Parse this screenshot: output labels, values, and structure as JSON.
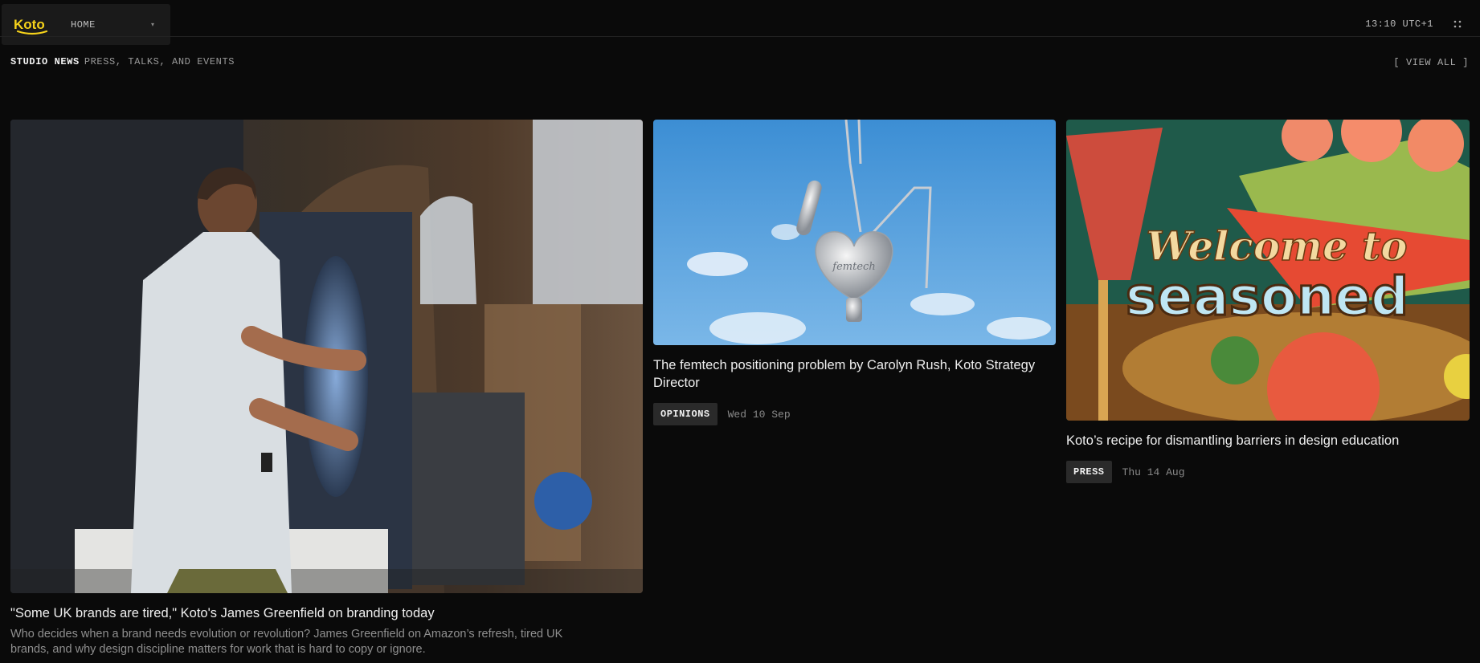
{
  "header": {
    "logo_text": "Koto",
    "nav_label": "HOME",
    "nav_caret": "▾",
    "clock": "13:10 UTC+1",
    "menu_icon": "grid-dots-icon"
  },
  "section": {
    "title": "STUDIO NEWS",
    "subtitle": "PRESS, TALKS, AND EVENTS",
    "view_all": "[ VIEW ALL ]"
  },
  "hero_text": {
    "welcome": "Welcome to",
    "seasoned": "seasoned",
    "pendant": "femtech"
  },
  "cards": [
    {
      "title": "\"Some UK brands are tired,\" Koto's James Greenfield on branding today",
      "description": "Who decides when a brand needs evolution or revolution? James Greenfield on Amazon’s refresh, tired UK brands, and why design discipline matters for work that is hard to copy or ignore."
    },
    {
      "title": "The femtech positioning problem by Carolyn Rush, Koto Strategy Director",
      "tag": "OPINIONS",
      "date": "Wed 10 Sep"
    },
    {
      "title": "Koto’s recipe for dismantling barriers in design education",
      "tag": "PRESS",
      "date": "Thu 14 Aug"
    }
  ],
  "colors": {
    "background": "#0a0a0a",
    "logo_yellow": "#f5d21a",
    "tag_bg": "#2a2a2a"
  }
}
